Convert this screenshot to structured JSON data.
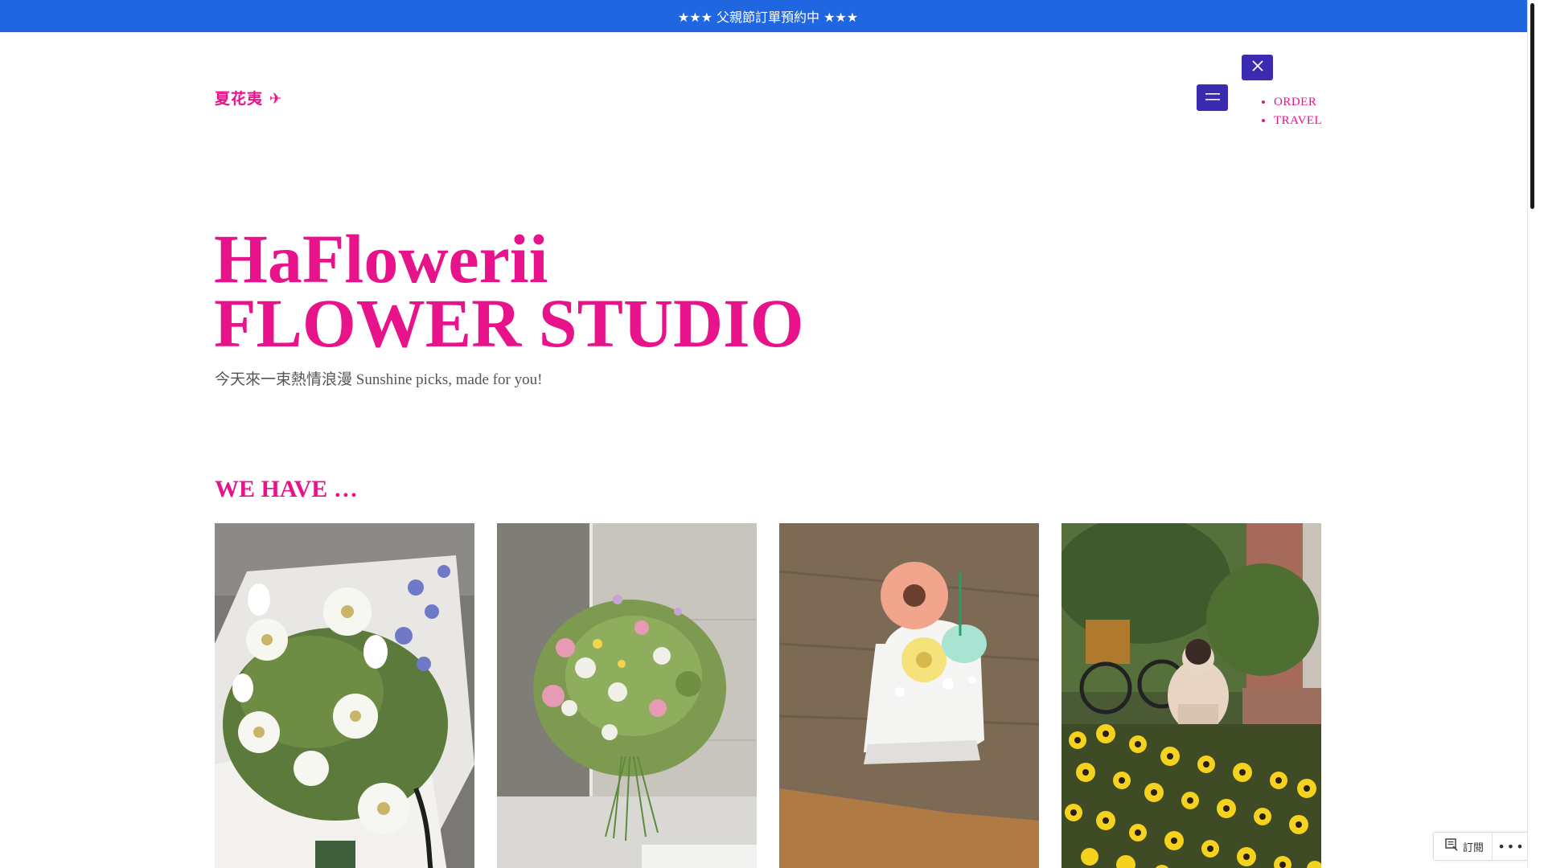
{
  "announcement": "★★★ 父親節訂單預約中 ★★★",
  "site_name": "夏花夷 ✈",
  "nav": {
    "items": [
      "ORDER",
      "TRAVEL"
    ],
    "open_icon": "hamburger-icon",
    "close_icon": "close-icon"
  },
  "hero": {
    "title_line1": "HaFlowerii",
    "title_line2": "FLOWER STUDIO",
    "subtitle": "今天來一束熱情浪漫 Sunshine picks, made for you!"
  },
  "section": {
    "heading": "WE HAVE …"
  },
  "gallery": {
    "items": [
      "white-gerbera-bouquet-photo",
      "wildflower-bouquet-photo",
      "flower-cake-photo",
      "yellow-flower-garden-photo"
    ]
  },
  "subscribe": {
    "label": "訂閱",
    "more": "•••"
  },
  "colors": {
    "accent": "#e8138a",
    "topbar": "#1f66e0",
    "button": "#3a2bb0"
  }
}
